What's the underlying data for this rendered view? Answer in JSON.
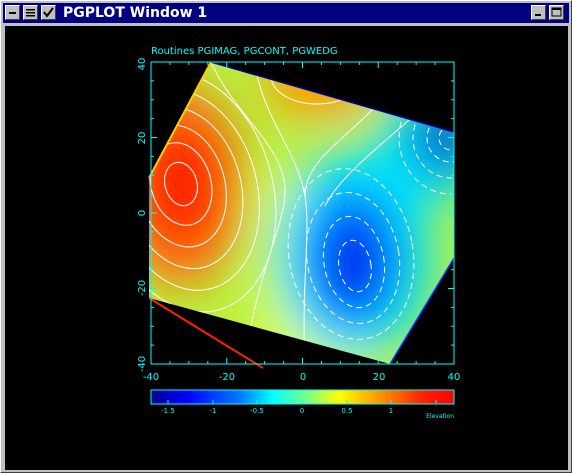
{
  "window": {
    "title": "PGPLOT Window 1",
    "buttons": [
      "system-menu-icon",
      "shade-icon",
      "menu-check-icon",
      "minimize-icon",
      "maximize-icon"
    ]
  },
  "plot": {
    "title": "Routines PGIMAG, PGCONT, PGWEDG",
    "axis_color": "#00ffff",
    "chart_data": {
      "type": "heatmap",
      "title": "Routines PGIMAG, PGCONT, PGWEDG",
      "xlim": [
        -40,
        40
      ],
      "ylim": [
        -40,
        40
      ],
      "x_ticks": [
        "-40",
        "-20",
        "0",
        "20",
        "40"
      ],
      "y_ticks": [
        "-40",
        "-20",
        "0",
        "20",
        "40"
      ],
      "colorbar": {
        "label": "Elevation",
        "range": [
          -1.8,
          1.6
        ],
        "ticks": [
          "-1.5",
          "-1",
          "-0.5",
          "0",
          "0.5",
          "1"
        ]
      },
      "features": [
        {
          "kind": "maximum",
          "x": -28,
          "y": 10
        },
        {
          "kind": "maximum",
          "x": 5,
          "y": 36
        },
        {
          "kind": "minimum",
          "x": 17,
          "y": -15
        },
        {
          "kind": "minimum",
          "x": 38,
          "y": 28
        }
      ],
      "contours": "white lines, dashed for negative levels"
    }
  }
}
